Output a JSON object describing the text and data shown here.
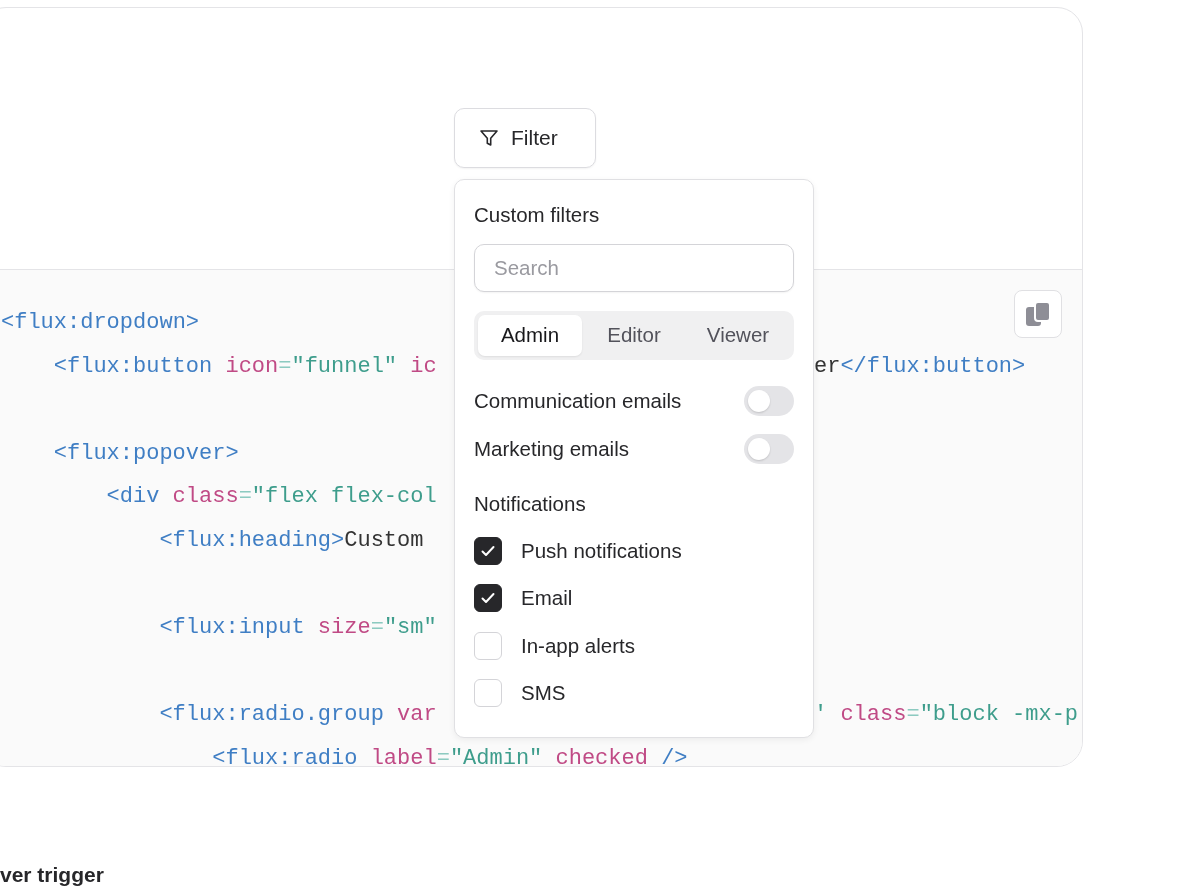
{
  "filter_button": {
    "label": "Filter"
  },
  "popover": {
    "heading": "Custom filters",
    "search": {
      "placeholder": "Search"
    },
    "tabs": [
      {
        "label": "Admin",
        "selected": true
      },
      {
        "label": "Editor",
        "selected": false
      },
      {
        "label": "Viewer",
        "selected": false
      }
    ],
    "toggles": [
      {
        "label": "Communication emails",
        "on": false
      },
      {
        "label": "Marketing emails",
        "on": false
      }
    ],
    "section_label": "Notifications",
    "checkboxes": [
      {
        "label": "Push notifications",
        "checked": true
      },
      {
        "label": "Email",
        "checked": true
      },
      {
        "label": "In-app alerts",
        "checked": false
      },
      {
        "label": "SMS",
        "checked": false
      }
    ]
  },
  "code": {
    "lines": [
      {
        "kind": "code",
        "tokens": [
          {
            "kind": "tag",
            "text": "<flux:dropdown>"
          }
        ],
        "children": [
          {
            "kind": "code",
            "tokens": [
              {
                "kind": "tag",
                "text": "<flux:button"
              },
              {
                "kind": "attr",
                "text": " icon"
              },
              {
                "kind": "eq",
                "text": "="
              },
              {
                "kind": "str",
                "text": "\"funnel\""
              },
              {
                "kind": "attr",
                "text": " ic"
              }
            ],
            "tail": [
              {
                "kind": "text",
                "text": "er"
              },
              {
                "kind": "tag",
                "text": "</flux:button>"
              }
            ]
          },
          {
            "kind": "blank"
          },
          {
            "kind": "code",
            "tokens": [
              {
                "kind": "tag",
                "text": "<flux:popover>"
              }
            ],
            "children": [
              {
                "kind": "code",
                "tokens": [
                  {
                    "kind": "tag",
                    "text": "<div"
                  },
                  {
                    "kind": "attr",
                    "text": " class"
                  },
                  {
                    "kind": "eq",
                    "text": "="
                  },
                  {
                    "kind": "str",
                    "text": "\"flex flex-col"
                  }
                ],
                "children": [
                  {
                    "kind": "code",
                    "tokens": [
                      {
                        "kind": "tag",
                        "text": "<flux:heading>"
                      },
                      {
                        "kind": "text",
                        "text": "Custom"
                      }
                    ]
                  },
                  {
                    "kind": "blank"
                  },
                  {
                    "kind": "code",
                    "tokens": [
                      {
                        "kind": "tag",
                        "text": "<flux:input"
                      },
                      {
                        "kind": "attr",
                        "text": " size"
                      },
                      {
                        "kind": "eq",
                        "text": "="
                      },
                      {
                        "kind": "str",
                        "text": "\"sm\""
                      }
                    ]
                  },
                  {
                    "kind": "blank"
                  },
                  {
                    "kind": "code",
                    "tokens": [
                      {
                        "kind": "tag",
                        "text": "<flux:radio.group"
                      },
                      {
                        "kind": "attr",
                        "text": " var"
                      }
                    ],
                    "tail": [
                      {
                        "kind": "str",
                        "text": "'"
                      },
                      {
                        "kind": "attr",
                        "text": " class"
                      },
                      {
                        "kind": "eq",
                        "text": "="
                      },
                      {
                        "kind": "str",
                        "text": "\"block -mx-p"
                      }
                    ],
                    "children": [
                      {
                        "kind": "code",
                        "tokens": [
                          {
                            "kind": "tag",
                            "text": "<flux:radio"
                          },
                          {
                            "kind": "attr",
                            "text": " label"
                          },
                          {
                            "kind": "eq",
                            "text": "="
                          },
                          {
                            "kind": "str",
                            "text": "\"Admin\""
                          },
                          {
                            "kind": "attr",
                            "text": " checked"
                          },
                          {
                            "kind": "tag",
                            "text": " />"
                          }
                        ]
                      }
                    ]
                  }
                ]
              }
            ]
          }
        ]
      }
    ]
  },
  "next_heading": "ver trigger"
}
